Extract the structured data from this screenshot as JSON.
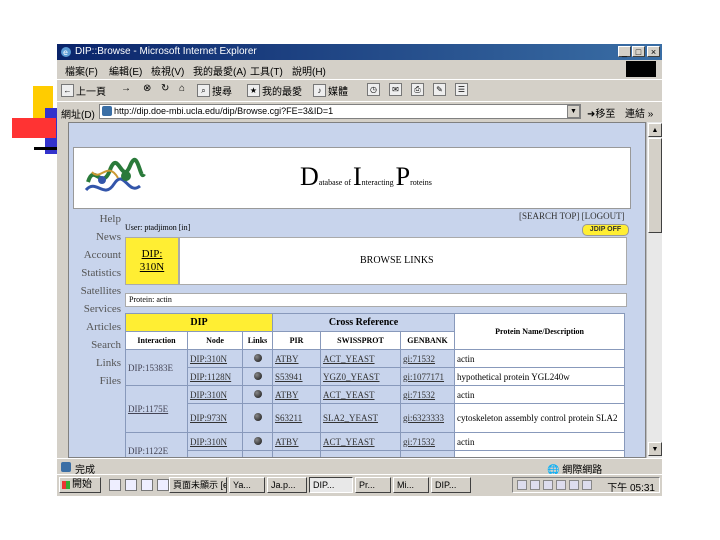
{
  "window": {
    "title": "DIP::Browse - Microsoft Internet Explorer",
    "controls": [
      "_",
      "□",
      "×"
    ]
  },
  "menu": [
    "檔案(F)",
    "編輯(E)",
    "檢視(V)",
    "我的最愛(A)",
    "工具(T)",
    "說明(H)"
  ],
  "toolbar": {
    "back": "上一頁",
    "forward": "→",
    "stop": "⊗",
    "refresh": "↻",
    "home": "⌂",
    "search": "搜尋",
    "favorites": "我的最愛",
    "media": "媒體"
  },
  "address": {
    "label": "網址(D)",
    "url": "http://dip.doe-mbi.ucla.edu/dip/Browse.cgi?FE=3&ID=1",
    "go": "移至",
    "links": "連結 »"
  },
  "page": {
    "db_title": {
      "d": "D",
      "d_rest": "atabase of ",
      "i": "I",
      "i_rest": "nteracting ",
      "p": "P",
      "p_rest": "roteins"
    },
    "nav": [
      "Help",
      "News",
      "Account",
      "Statistics",
      "Satellites",
      "Services",
      "Articles",
      "Search",
      "Links",
      "Files"
    ],
    "user": "User: ptadjimon [in]",
    "toplinks": "[SEARCH TOP] [LOGOUT]",
    "toggle": "JDIP OFF",
    "dip_id": "DIP:",
    "dip_node": "310N",
    "browse_title": "BROWSE LINKS",
    "protein_line": "Protein: actin",
    "table": {
      "group_dip": "DIP",
      "group_cross": "Cross Reference",
      "col_desc": "Protein Name/Description",
      "cols": [
        "Interaction",
        "Node",
        "Links",
        "PIR",
        "SWISSPROT",
        "GENBANK"
      ],
      "groups": [
        {
          "interaction": "DIP:15383E",
          "rows": [
            {
              "node": "DIP:310N",
              "pir": "ATBY",
              "swiss": "ACT_YEAST",
              "genbank": "gi:71532",
              "desc": "actin"
            },
            {
              "node": "DIP:1128N",
              "pir": "S53941",
              "swiss": "YGZ0_YEAST",
              "genbank": "gi:1077171",
              "desc": "hypothetical protein YGL240w"
            }
          ]
        },
        {
          "interaction": "DIP:1175E",
          "rows": [
            {
              "node": "DIP:310N",
              "pir": "ATBY",
              "swiss": "ACT_YEAST",
              "genbank": "gi:71532",
              "desc": "actin"
            },
            {
              "node": "DIP:973N",
              "pir": "S63211",
              "swiss": "SLA2_YEAST",
              "genbank": "gi:6323333",
              "desc": "cytoskeleton assembly control protein SLA2"
            }
          ]
        },
        {
          "interaction": "DIP:1122E",
          "rows": [
            {
              "node": "DIP:310N",
              "pir": "ATBY",
              "swiss": "ACT_YEAST",
              "genbank": "gi:71532",
              "desc": "actin"
            }
          ]
        }
      ]
    }
  },
  "status": {
    "text": "完成",
    "zone": "網際網路"
  },
  "taskbar": {
    "start": "開始",
    "tasks": [
      "頁面未顯示 [el...",
      "Ya...",
      "Ja.p...",
      "DIP...",
      "Pr...",
      "Mi...",
      "DIP..."
    ],
    "clock": "下午 05:31"
  }
}
